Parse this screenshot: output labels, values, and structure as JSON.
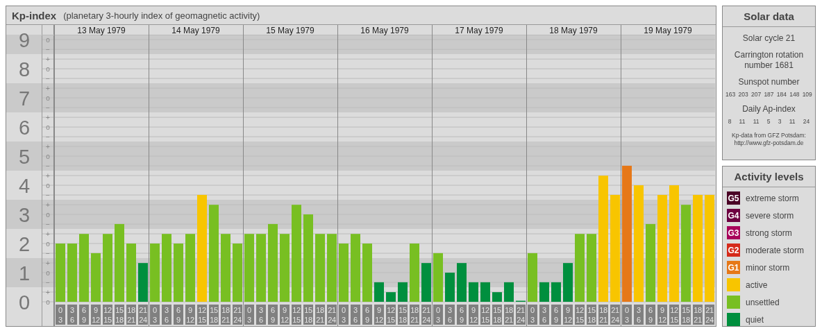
{
  "kp_panel": {
    "title": "Kp-index",
    "subtitle": "(planetary 3-hourly index of geomagnetic activity)",
    "days": [
      "13 May 1979",
      "14 May 1979",
      "15 May 1979",
      "16 May 1979",
      "17 May 1979",
      "18 May 1979",
      "19 May 1979"
    ],
    "scale_marks": [
      "o",
      "−",
      "+",
      "o",
      "−",
      "+",
      "o",
      "−",
      "+",
      "o",
      "−",
      "+",
      "o",
      "−",
      "+",
      "o",
      "−",
      "+",
      "o",
      "−",
      "+",
      "o",
      "−",
      "+",
      "o",
      "−",
      "+",
      "o"
    ],
    "chart_data": {
      "type": "bar",
      "grid": true,
      "ylim": [
        0,
        9.17
      ],
      "yticks": [
        {
          "value": 9,
          "label": "9"
        },
        {
          "value": 8,
          "label": "8"
        },
        {
          "value": 7,
          "label": "7"
        },
        {
          "value": 6,
          "label": "6"
        },
        {
          "value": 5,
          "label": "5"
        },
        {
          "value": 4,
          "label": "4"
        },
        {
          "value": 3,
          "label": "3"
        },
        {
          "value": 2,
          "label": "2"
        },
        {
          "value": 1,
          "label": "1"
        },
        {
          "value": 0,
          "label": "0"
        }
      ],
      "categories": [
        "0 3",
        "3 6",
        "6 9",
        "9 12",
        "12 15",
        "15 18",
        "18 21",
        "21 24",
        "0 3",
        "3 6",
        "6 9",
        "9 12",
        "12 15",
        "15 18",
        "18 21",
        "21 24",
        "0 3",
        "3 6",
        "6 9",
        "9 12",
        "12 15",
        "15 18",
        "18 21",
        "21 24",
        "0 3",
        "3 6",
        "6 9",
        "9 12",
        "12 15",
        "15 18",
        "18 21",
        "21 24",
        "0 3",
        "3 6",
        "6 9",
        "9 12",
        "12 15",
        "15 18",
        "18 21",
        "21 24",
        "0 3",
        "3 6",
        "6 9",
        "9 12",
        "12 15",
        "15 18",
        "18 21",
        "21 24",
        "0 3",
        "3 6",
        "6 9",
        "9 12",
        "12 15",
        "15 18",
        "18 21",
        "21 24"
      ],
      "series": [
        {
          "color": "#008f3e",
          "values": [
            null,
            null,
            null,
            null,
            null,
            null,
            null,
            1.33,
            null,
            null,
            null,
            null,
            null,
            null,
            null,
            null,
            null,
            null,
            null,
            null,
            null,
            null,
            null,
            null,
            null,
            null,
            null,
            0.67,
            0.33,
            0.67,
            null,
            1.33,
            null,
            1,
            1.33,
            0.67,
            0.67,
            0.33,
            0.67,
            0,
            null,
            0.67,
            0.67,
            1.33,
            null,
            null,
            null,
            null,
            null,
            null,
            null,
            null,
            null,
            null,
            null,
            null
          ]
        },
        {
          "color": "#78bf22",
          "values": [
            2,
            2,
            2.33,
            1.67,
            2.33,
            2.67,
            2,
            null,
            2,
            2.33,
            2,
            2.33,
            null,
            3.33,
            2.33,
            2,
            2.33,
            2.33,
            2.67,
            2.33,
            3.33,
            3,
            2.33,
            2.33,
            2,
            2.33,
            2,
            null,
            null,
            null,
            2,
            null,
            1.67,
            null,
            null,
            null,
            null,
            null,
            null,
            null,
            1.67,
            null,
            null,
            null,
            2.33,
            2.33,
            null,
            null,
            null,
            null,
            2.67,
            null,
            null,
            3.33,
            null,
            null
          ]
        },
        {
          "color": "#f8c500",
          "values": [
            null,
            null,
            null,
            null,
            null,
            null,
            null,
            null,
            null,
            null,
            null,
            null,
            3.67,
            null,
            null,
            null,
            null,
            null,
            null,
            null,
            null,
            null,
            null,
            null,
            null,
            null,
            null,
            null,
            null,
            null,
            null,
            null,
            null,
            null,
            null,
            null,
            null,
            null,
            null,
            null,
            null,
            null,
            null,
            null,
            null,
            null,
            4.33,
            3.67,
            null,
            4,
            null,
            3.67,
            4,
            null,
            3.67,
            3.67
          ]
        },
        {
          "color": "#e67818",
          "values": [
            null,
            null,
            null,
            null,
            null,
            null,
            null,
            null,
            null,
            null,
            null,
            null,
            null,
            null,
            null,
            null,
            null,
            null,
            null,
            null,
            null,
            null,
            null,
            null,
            null,
            null,
            null,
            null,
            null,
            null,
            null,
            null,
            null,
            null,
            null,
            null,
            null,
            null,
            null,
            null,
            null,
            null,
            null,
            null,
            null,
            null,
            null,
            null,
            4.67,
            null,
            null,
            null,
            null,
            null,
            null,
            null
          ]
        }
      ]
    }
  },
  "solar_data": {
    "title": "Solar data",
    "cycle": "Solar cycle 21",
    "carrington": "Carrington rotation number 1681",
    "sunspot_title": "Sunspot number",
    "sunspot_numbers": [
      "163",
      "203",
      "207",
      "187",
      "184",
      "148",
      "109"
    ],
    "ap_title": "Daily Ap-index",
    "ap_values": [
      "8",
      "11",
      "11",
      "5",
      "3",
      "11",
      "24"
    ],
    "source_note": "Kp-data from GFZ Potsdam:",
    "source_link": "http://www.gfz-potsdam.de"
  },
  "activity_levels": {
    "title": "Activity levels",
    "items": [
      {
        "badge": "G5",
        "label": "extreme storm",
        "color": "#4a0025"
      },
      {
        "badge": "G4",
        "label": "severe storm",
        "color": "#6d0040"
      },
      {
        "badge": "G3",
        "label": "strong storm",
        "color": "#a8005a"
      },
      {
        "badge": "G2",
        "label": "moderate storm",
        "color": "#d52a1a"
      },
      {
        "badge": "G1",
        "label": "minor storm",
        "color": "#e67818"
      },
      {
        "label": "active",
        "color": "#f8c500"
      },
      {
        "label": "unsettled",
        "color": "#78bf22"
      },
      {
        "label": "quiet",
        "color": "#008f3e"
      }
    ]
  }
}
